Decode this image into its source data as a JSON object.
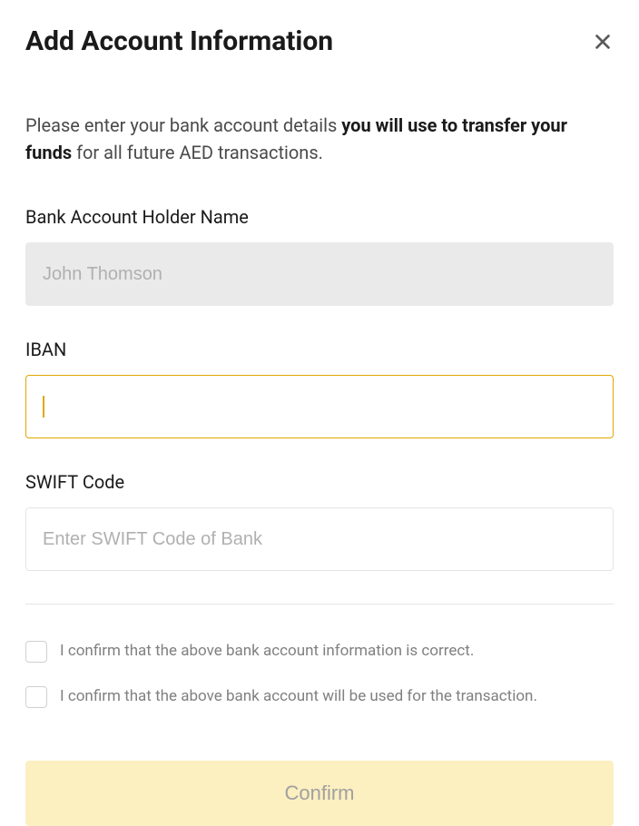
{
  "header": {
    "title": "Add Account Information"
  },
  "description": {
    "prefix": "Please enter your bank account details ",
    "bold": "you will use to transfer your funds",
    "suffix": " for all future AED transactions."
  },
  "fields": {
    "holder": {
      "label": "Bank Account Holder Name",
      "value": "John Thomson"
    },
    "iban": {
      "label": "IBAN",
      "value": ""
    },
    "swift": {
      "label": "SWIFT Code",
      "placeholder": "Enter SWIFT Code of Bank",
      "value": ""
    }
  },
  "checkboxes": {
    "confirm_info": "I confirm that the above bank account information is correct.",
    "confirm_use": "I confirm that the above bank account will be used for the transaction."
  },
  "buttons": {
    "confirm": "Confirm"
  }
}
